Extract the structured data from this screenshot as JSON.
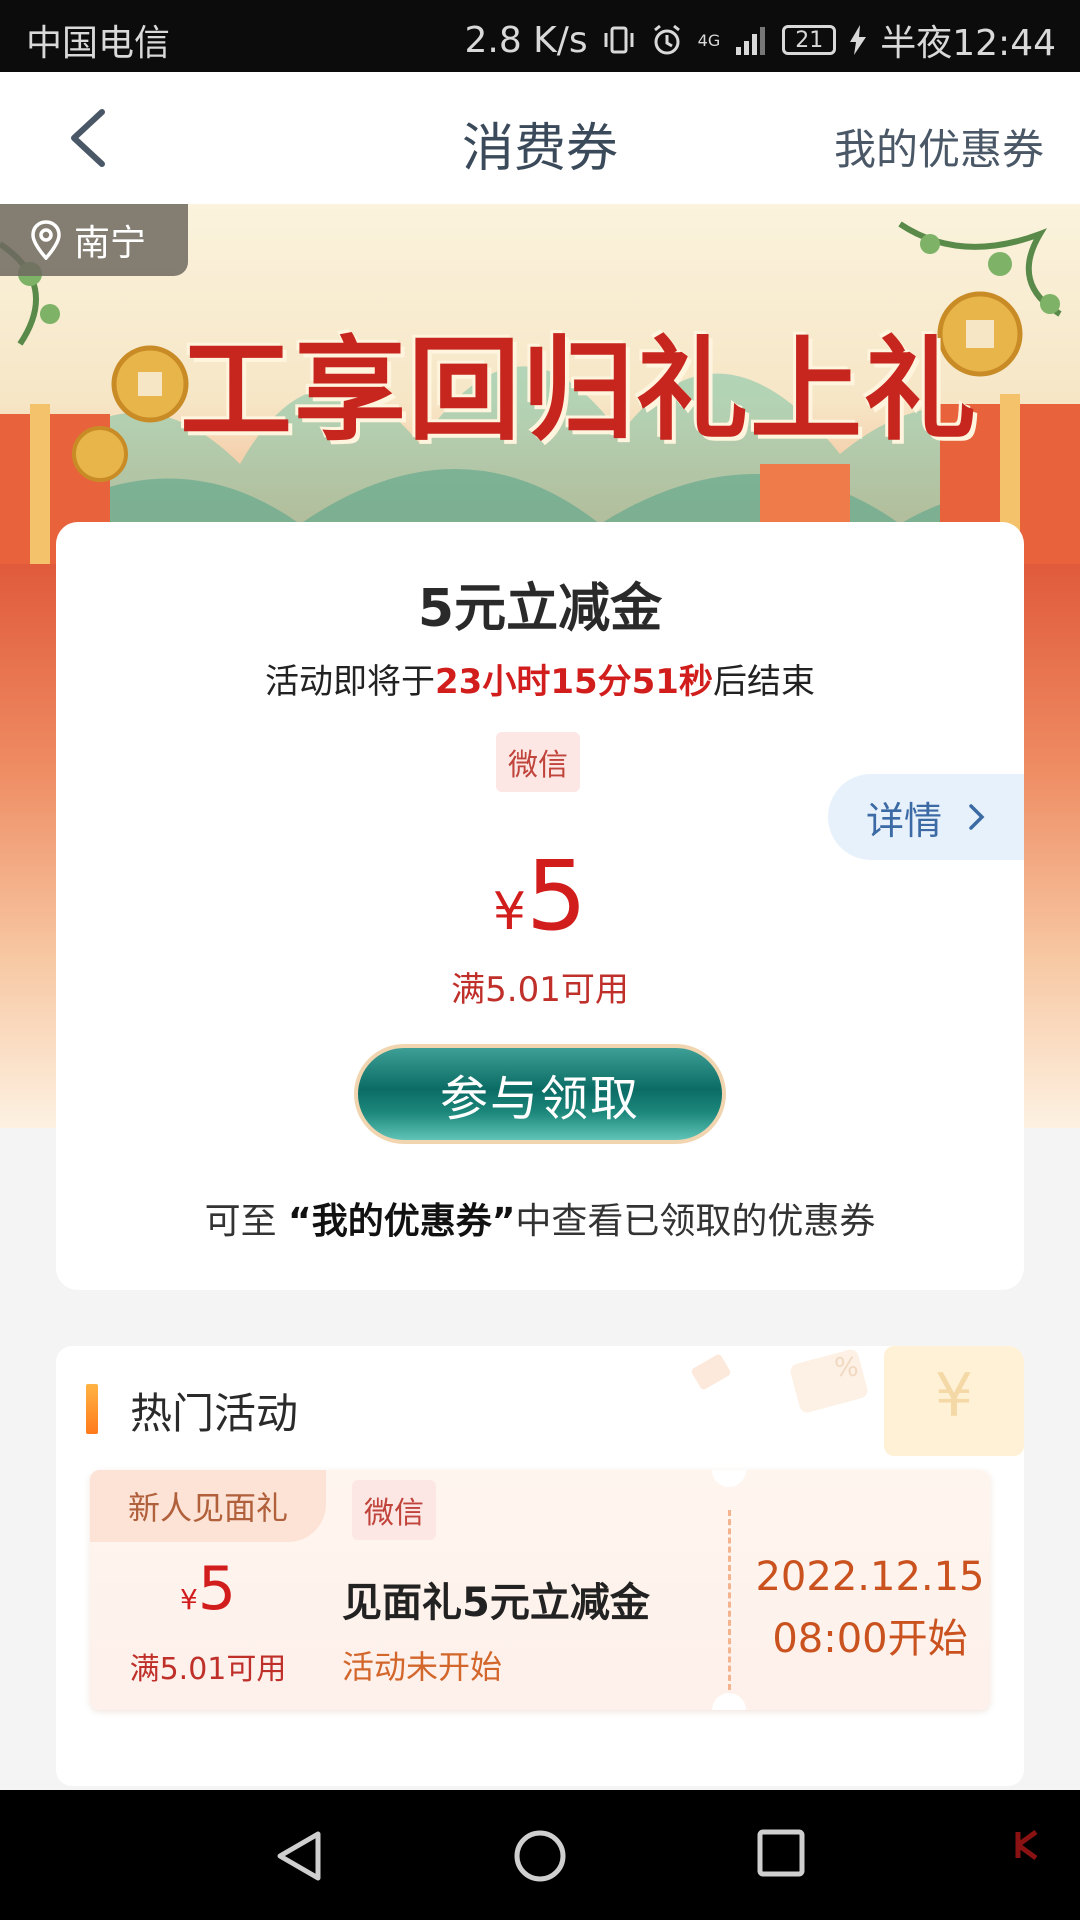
{
  "status_bar": {
    "carrier": "中国电信",
    "net_speed": "2.8 K/s",
    "network": "4G",
    "battery": "21",
    "time": "半夜12:44"
  },
  "nav": {
    "title": "消费券",
    "right_link": "我的优惠券"
  },
  "banner": {
    "location": "南宁",
    "headline": "工享回归礼上礼"
  },
  "coupon": {
    "title": "5元立减金",
    "countdown_prefix": "活动即将于",
    "countdown": "23小时15分51秒",
    "countdown_suffix": "后结束",
    "channel_tag": "微信",
    "detail_label": "详情",
    "currency": "¥",
    "amount": "5",
    "condition": "满5.01可用",
    "button_label": "参与领取",
    "hint_prefix": "可至 ",
    "hint_bold": "“我的优惠券”",
    "hint_suffix": "中查看已领取的优惠券"
  },
  "hot_activities": {
    "title": "热门活动",
    "items": [
      {
        "badge": "新人见面礼",
        "channel_tag": "微信",
        "currency": "¥",
        "amount": "5",
        "condition": "满5.01可用",
        "name": "见面礼5元立减金",
        "status": "活动未开始",
        "start_date": "2022.12.15",
        "start_time": "08:00开始"
      }
    ]
  },
  "colors": {
    "accent_red": "#d21d1d",
    "button_teal": "#0b6c65",
    "nav_text": "#3b4a5a"
  }
}
